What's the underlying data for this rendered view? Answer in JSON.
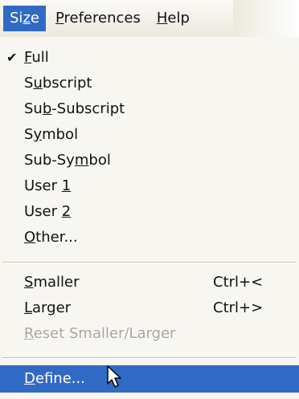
{
  "menubar": {
    "items": [
      {
        "before": "Si",
        "mn": "z",
        "after": "e",
        "active": true
      },
      {
        "before": "",
        "mn": "P",
        "after": "references",
        "active": false
      },
      {
        "before": "",
        "mn": "H",
        "after": "elp",
        "active": false
      }
    ]
  },
  "menu": {
    "items": [
      {
        "before": "",
        "mn": "F",
        "after": "ull",
        "checked": true,
        "check_glyph": "✔"
      },
      {
        "before": "S",
        "mn": "u",
        "after": "bscript"
      },
      {
        "before": "Su",
        "mn": "b",
        "after": "-Subscript"
      },
      {
        "before": "S",
        "mn": "y",
        "after": "mbol"
      },
      {
        "before": "Sub-Sy",
        "mn": "m",
        "after": "bol"
      },
      {
        "before": "User ",
        "mn": "1",
        "after": ""
      },
      {
        "before": "User ",
        "mn": "2",
        "after": ""
      },
      {
        "before": "",
        "mn": "O",
        "after": "ther..."
      },
      {
        "before": "",
        "mn": "S",
        "after": "maller",
        "shortcut": "Ctrl+<"
      },
      {
        "before": "",
        "mn": "L",
        "after": "arger",
        "shortcut": "Ctrl+>"
      },
      {
        "before": "",
        "mn": "R",
        "after": "eset Smaller/Larger",
        "disabled": true
      },
      {
        "before": "",
        "mn": "D",
        "after": "efine...",
        "highlighted": true
      }
    ]
  },
  "colors": {
    "highlight": "#316ac5",
    "disabled": "#a7a59b",
    "menu_bg": "#f7f6f1"
  }
}
